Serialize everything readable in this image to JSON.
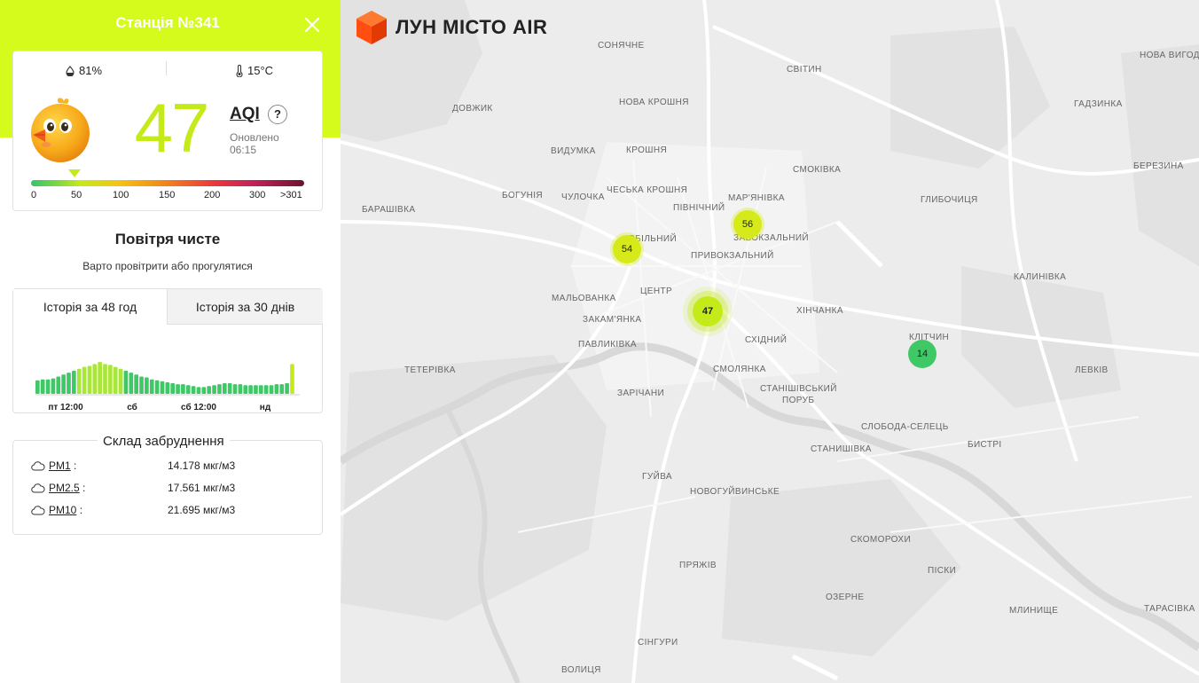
{
  "sidebar": {
    "station_title": "Станція №341",
    "humidity": "81%",
    "temperature": "15°C",
    "aqi_value": "47",
    "aqi_label": "AQI",
    "help": "?",
    "updated_label": "Оновлено",
    "updated_time": "06:15",
    "scale_labels": [
      "0",
      "50",
      "100",
      "150",
      "200",
      "300",
      ">301"
    ],
    "status_title": "Повітря чисте",
    "status_advice": "Варто провітрити або прогулятися",
    "tabs": [
      "Історія за 48 год",
      "Історія за 30 днів"
    ],
    "history_labels": [
      "пт 12:00",
      "сб",
      "сб 12:00",
      "нд"
    ],
    "composition_title": "Склад забруднення",
    "pollutants": [
      {
        "name": "PM1",
        "value": "14.178 мкг/м3"
      },
      {
        "name": "PM2.5",
        "value": "17.561 мкг/м3"
      },
      {
        "name": "PM10",
        "value": "21.695 мкг/м3"
      }
    ]
  },
  "chart_data": {
    "type": "bar",
    "title": "Історія за 48 год",
    "x_ticks": [
      "пт 12:00",
      "сб",
      "сб 12:00",
      "нд"
    ],
    "values": [
      14,
      15,
      15,
      16,
      18,
      20,
      22,
      24,
      26,
      28,
      29,
      31,
      33,
      31,
      30,
      28,
      26,
      24,
      22,
      20,
      18,
      17,
      15,
      14,
      13,
      12,
      11,
      10,
      10,
      9,
      8,
      7,
      7,
      8,
      9,
      10,
      11,
      11,
      10,
      10,
      9,
      9,
      9,
      9,
      9,
      9,
      10,
      10,
      11,
      31
    ],
    "colors": {
      "green": "#3fc866",
      "lime": "#a9e63a",
      "current": "#c5ea1a"
    }
  },
  "map": {
    "logo": "ЛУН МІСТО AIR",
    "places": [
      "СОНЯЧНЕ",
      "СВІТИН",
      "НОВА ВИГОДА",
      "ДОВЖИК",
      "НОВА КРОШНЯ",
      "ГАДЗИНКА",
      "ВИДУМКА",
      "КРОШНЯ",
      "СМОКІВКА",
      "БЕРЕЗИНА",
      "БОГУНІЯ",
      "ЧУЛОЧКА",
      "ЧЕСЬКА КРОШНЯ",
      "МАР'ЯНІВКА",
      "ПІВНІЧНИЙ",
      "ГЛИБОЧИЦЯ",
      "БАРАШІВКА",
      "ЗАВОКЗАЛЬНИЙ",
      "ПРИВОКЗАЛЬНИЙ",
      "ОБІЛЬНИЙ",
      "КАЛИНІВКА",
      "ЦЕНТР",
      "МАЛЬОВАНКА",
      "ХІНЧАНКА",
      "ЗАКАМ'ЯНКА",
      "КЛІТЧИН",
      "СХІДНИЙ",
      "ПАВЛИКІВКА",
      "ЛЕВКІВ",
      "ТЕТЕРІВКА",
      "СМОЛЯНКА",
      "СТАНІШІВСЬКИЙ",
      "ПОРУБ",
      "ЗАРІЧАНИ",
      "СЛОБОДА-СЕЛЕЦЬ",
      "БИСТРІ",
      "СТАНИШІВКА",
      "ГУЙВА",
      "НОВОГУЙВИНСЬКЕ",
      "СКОМОРОХИ",
      "ПРЯЖІВ",
      "ПІСКИ",
      "ОЗЕРНЕ",
      "МЛИНИЩЕ",
      "ТАРАСІВКА",
      "СІНГУРИ",
      "ВОЛИЦЯ"
    ],
    "markers": [
      "56",
      "54",
      "47",
      "14"
    ]
  }
}
